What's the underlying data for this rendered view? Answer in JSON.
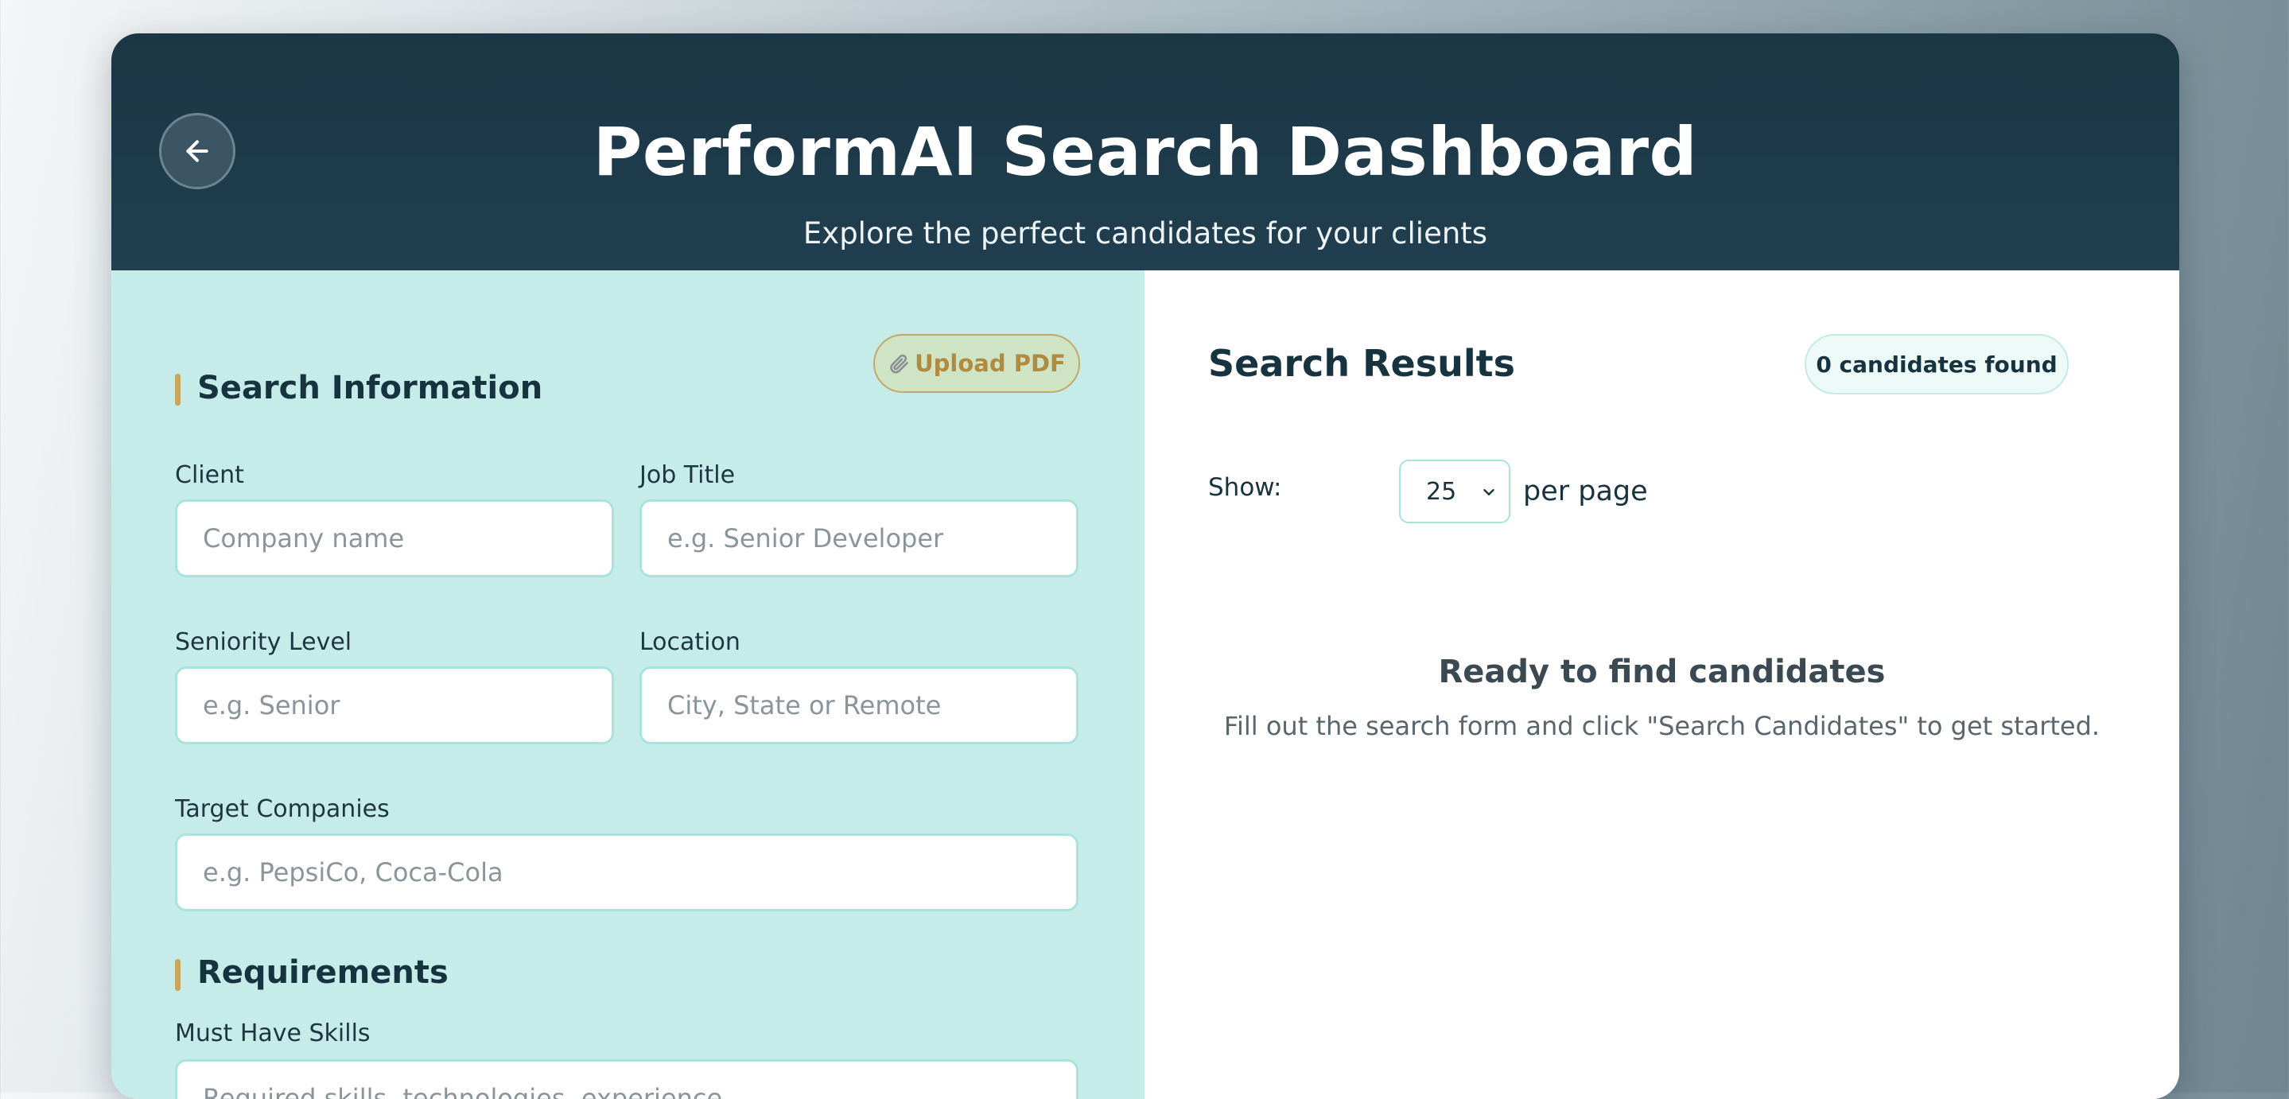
{
  "header": {
    "title": "PerformAI Search Dashboard",
    "subtitle": "Explore the perfect candidates for your clients",
    "back_icon": "arrow-left-icon"
  },
  "search_form": {
    "section_title": "Search Information",
    "upload_button": {
      "icon": "paperclip-icon",
      "label": "Upload PDF"
    },
    "fields": {
      "client": {
        "label": "Client",
        "placeholder": "Company name",
        "value": ""
      },
      "job_title": {
        "label": "Job Title",
        "placeholder": "e.g. Senior Developer",
        "value": ""
      },
      "seniority": {
        "label": "Seniority Level",
        "placeholder": "e.g. Senior",
        "value": ""
      },
      "location": {
        "label": "Location",
        "placeholder": "City, State or Remote",
        "value": ""
      },
      "target_companies": {
        "label": "Target Companies",
        "placeholder": "e.g. PepsiCo, Coca-Cola",
        "value": ""
      }
    },
    "requirements": {
      "section_title": "Requirements",
      "must_have": {
        "label": "Must Have Skills",
        "placeholder": "Required skills, technologies, experience...",
        "value": ""
      }
    }
  },
  "results": {
    "title": "Search Results",
    "count_badge": "0 candidates found",
    "show_label": "Show:",
    "per_page_value": "25",
    "per_page_label": "per page",
    "empty_title": "Ready to find candidates",
    "empty_text": "Fill out the search form and click \"Search Candidates\" to get started."
  },
  "colors": {
    "header_bg": "#1b3645",
    "left_panel_bg": "#c6ece9",
    "accent_gold": "#c9a65a",
    "input_border": "#a9e3df",
    "text_dark": "#17333f"
  }
}
